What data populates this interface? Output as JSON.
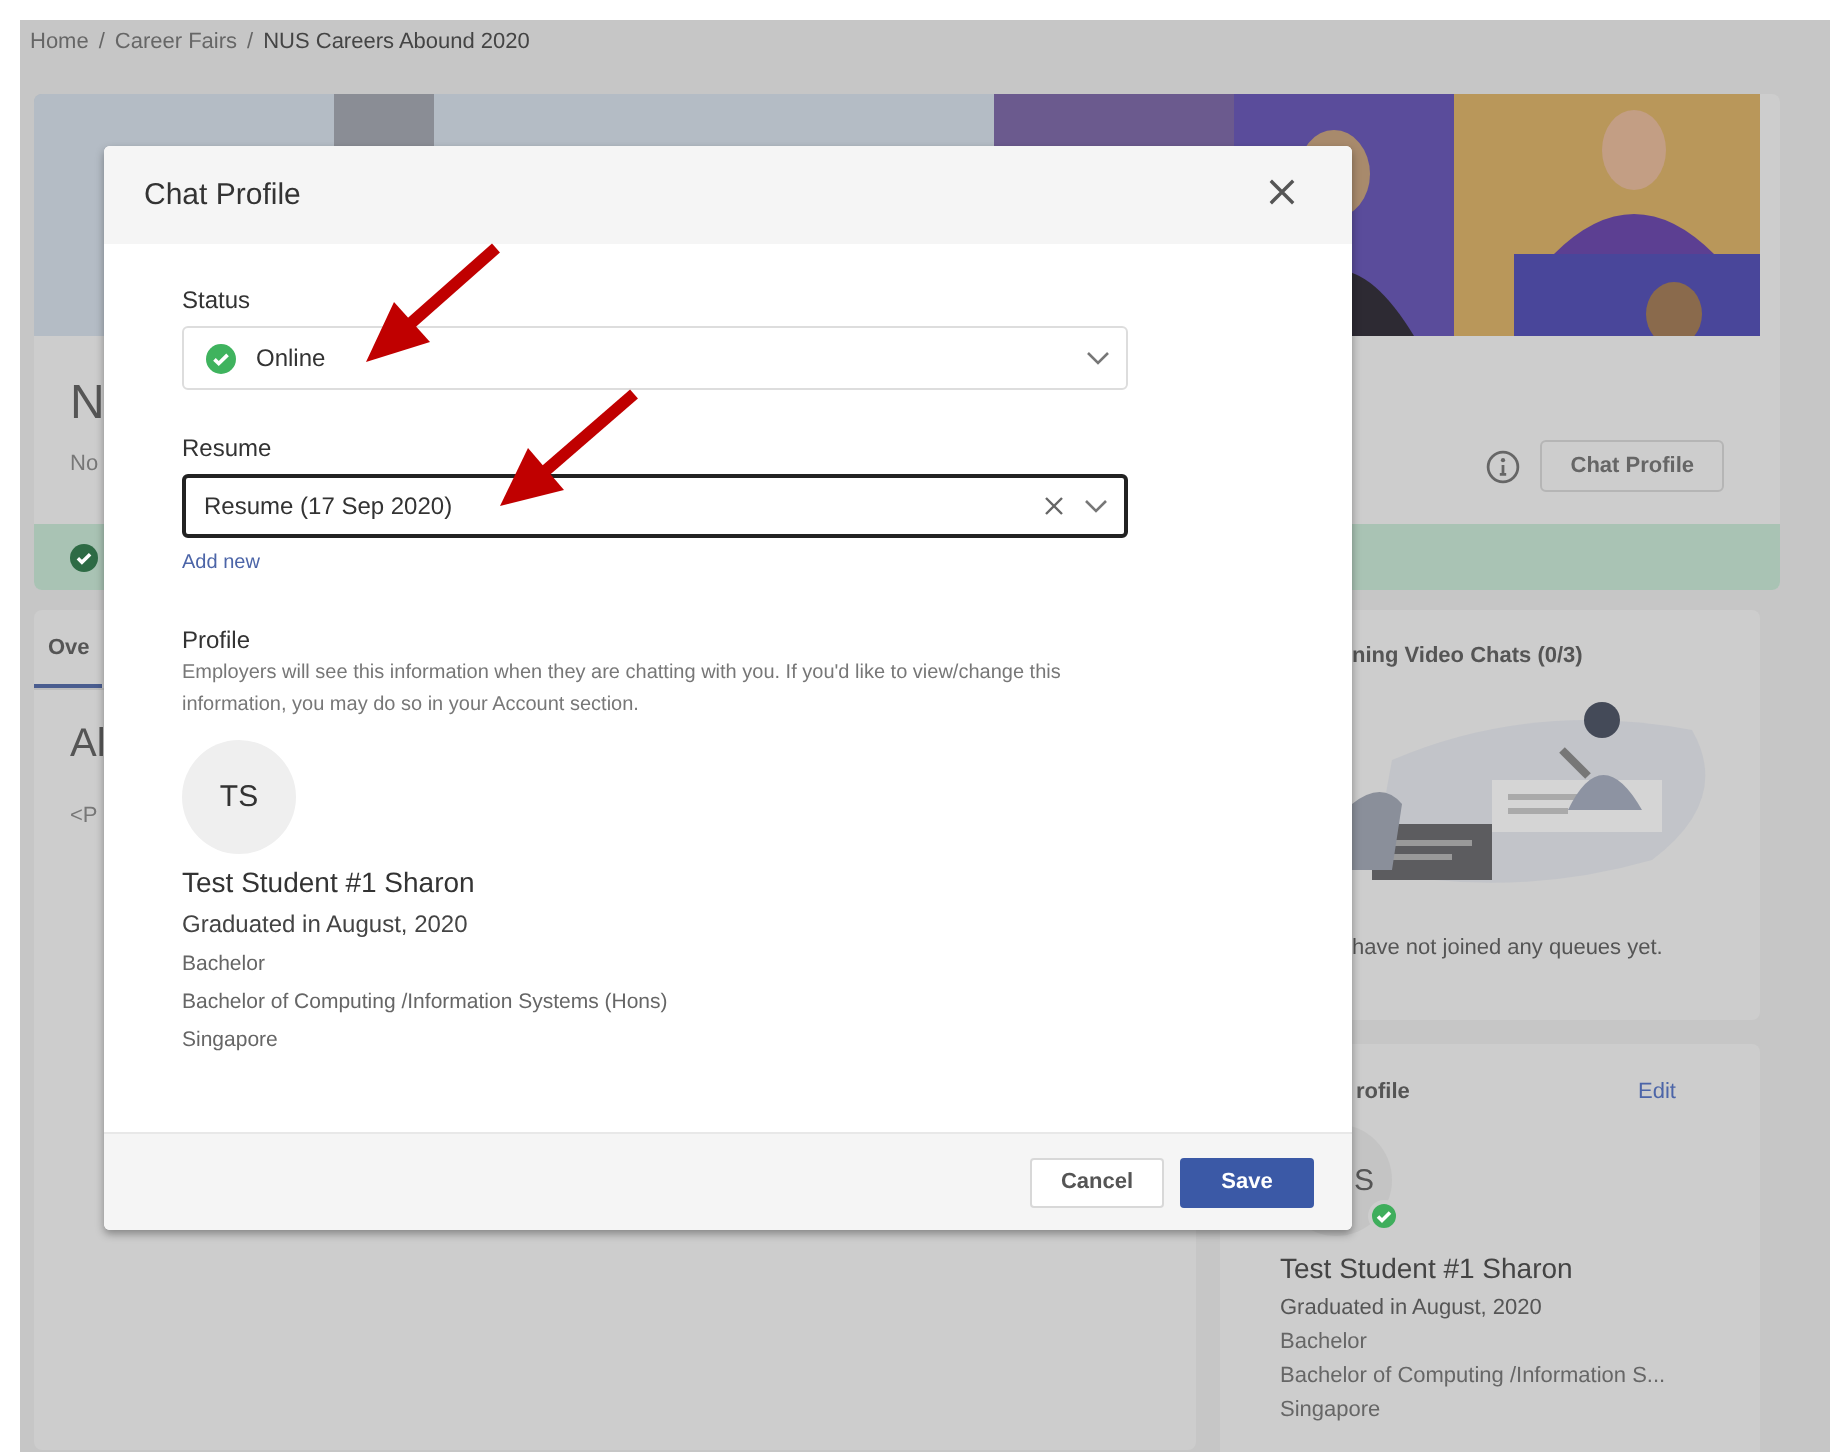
{
  "breadcrumb": {
    "separator": "/",
    "items": [
      {
        "label": "Home"
      },
      {
        "label": "Career Fairs"
      },
      {
        "label": "NUS Careers Abound 2020"
      }
    ]
  },
  "event_header": {
    "title": "N",
    "subtitle": "No",
    "chat_profile_button": "Chat Profile"
  },
  "alert": {
    "kind": "success"
  },
  "tabs": [
    {
      "label": "Ove",
      "selected": true
    }
  ],
  "overview": {
    "heading": "Al",
    "body": "<P"
  },
  "video_chats": {
    "title": "ning Video Chats (0/3)",
    "empty_text": "have not joined any queues yet."
  },
  "profile_card": {
    "title": "rofile",
    "edit": "Edit",
    "initials": "S",
    "online": true,
    "name": "Test Student #1 Sharon",
    "graduated": "Graduated in August, 2020",
    "details": [
      "Bachelor",
      "Bachelor of Computing /Information S...",
      "Singapore"
    ]
  },
  "dialog": {
    "title": "Chat Profile",
    "status": {
      "label": "Status",
      "value": "Online",
      "online": true
    },
    "resume": {
      "label": "Resume",
      "value": "Resume (17 Sep 2020)",
      "focused": true
    },
    "add_new": "Add new",
    "profile": {
      "label": "Profile",
      "description": "Employers will see this information when they are chatting with you. If you'd like to view/change this information, you may do so in your Account section.",
      "initials": "TS",
      "name": "Test Student #1 Sharon",
      "graduated": "Graduated in August, 2020",
      "details": [
        "Bachelor",
        "Bachelor of Computing /Information Systems (Hons)",
        "Singapore"
      ]
    },
    "buttons": [
      {
        "label": "Cancel",
        "kind": "secondary"
      },
      {
        "label": "Save",
        "kind": "primary"
      }
    ]
  }
}
